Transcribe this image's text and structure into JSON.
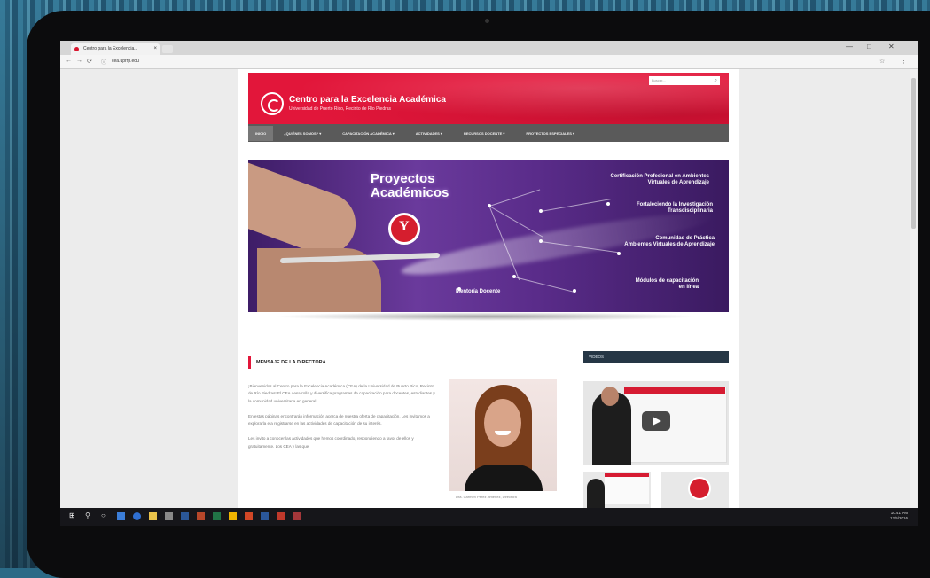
{
  "browser": {
    "tab_title": "Centro para la Excelencia...",
    "tab_close": "×",
    "url": "cea.uprrp.edu",
    "window_controls": [
      "—",
      "□",
      "✕"
    ],
    "nav": [
      "←",
      "→",
      "⟳"
    ],
    "addr_icons": [
      "☆",
      "⋮"
    ]
  },
  "site": {
    "title": "Centro para la Excelencia Académica",
    "subtitle": "Universidad de Puerto Rico, Recinto de Río Piedras",
    "search_placeholder": "Buscar...",
    "menu": [
      {
        "label": "INICIO",
        "active": true
      },
      {
        "label": "¿QUIÉNES SOMOS? ▾",
        "active": false
      },
      {
        "label": "CAPACITACIÓN ACADÉMICA ▾",
        "active": false
      },
      {
        "label": "ACTIVIDADES ▾",
        "active": false
      },
      {
        "label": "RECURSOS DOCENTE ▾",
        "active": false
      },
      {
        "label": "PROYECTOS ESPECIALES ▾",
        "active": false
      }
    ],
    "banner": {
      "heading_line1": "Proyectos",
      "heading_line2": "Académicos",
      "items": [
        {
          "line1": "Certificación Profesional en Ambientes",
          "line2": "Virtuales de Aprendizaje"
        },
        {
          "line1": "Fortaleciendo la Investigación",
          "line2": "Transdisciplinaria"
        },
        {
          "line1": "Comunidad de Práctica",
          "line2": "Ambientes Virtuales de Aprendizaje"
        },
        {
          "line1": "Mentoría Docente",
          "line2": ""
        },
        {
          "line1": "Módulos de capacitación",
          "line2": "en línea"
        }
      ]
    },
    "message": {
      "heading": "MENSAJE DE LA DIRECTORA",
      "paragraphs": [
        "¡Bienvenidos al Centro para la Excelencia Académica (CEA) de la Universidad de Puerto Rico, Recinto de Río Piedras! El CEA desarrolla y diversifica programas de capacitación para docentes, estudiantes y la comunidad universitaria en general.",
        "En estas páginas encontrarán información acerca de nuestra oferta de capacitación. Les invitamos a explorarla e a registrarse en las actividades de capacitación de su interés.",
        "Les invito a conocer las actividades que hemos coordinado, respondiendo a favor de ellos y gratuitamente. Los CEA y las que"
      ],
      "caption": "Dra. Carmen Pérez Jiménez, Directora"
    },
    "sidebar_heading": "VIDEOS"
  },
  "taskbar": {
    "clock_time": "10:41 PM",
    "clock_date": "12/5/2016"
  },
  "colors": {
    "brand_red": "#e2163a",
    "menu_gray": "#5a5a5a",
    "banner_purple": "#5a2c8a",
    "sidebar_navy": "#253645"
  }
}
